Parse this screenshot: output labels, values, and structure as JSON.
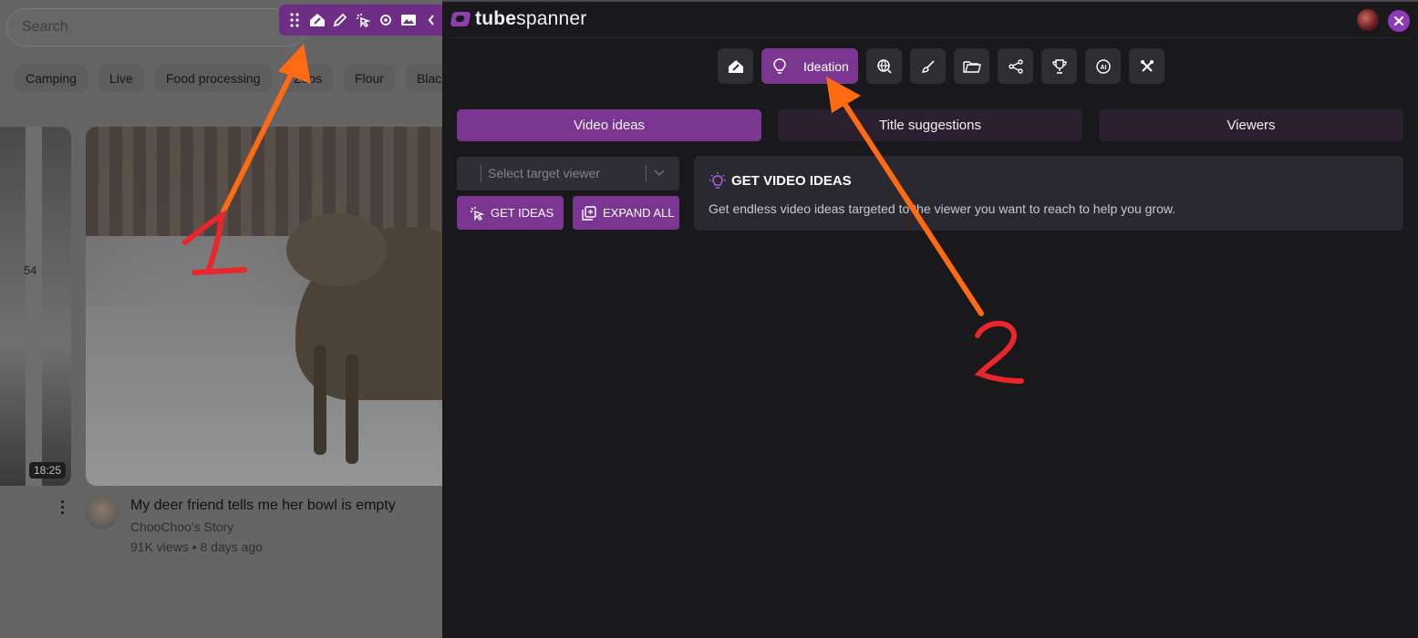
{
  "youtube": {
    "search_placeholder": "Search",
    "chips": [
      "Camping",
      "Live",
      "Food processing",
      "Zoos",
      "Flour",
      "Blac"
    ],
    "left_thumb_duration": "18:25",
    "left_thumb_sign": "54",
    "video": {
      "title": "My deer friend tells me her bowl is empty",
      "channel": "ChooChoo's Story",
      "meta": "91K views • 8 days ago"
    }
  },
  "extension": {
    "brand_first": "tube",
    "brand_second": "spanner",
    "nav": {
      "active_label": "Ideation",
      "items": [
        "dashboard-icon",
        "lightbulb-icon",
        "globe-search-icon",
        "brush-icon",
        "folder-icon",
        "share-icon",
        "trophy-icon",
        "ai-icon",
        "tools-icon"
      ]
    },
    "tabs": [
      "Video ideas",
      "Title suggestions",
      "Viewers"
    ],
    "select_placeholder": "Select target viewer",
    "get_ideas_label": "GET IDEAS",
    "expand_all_label": "EXPAND ALL",
    "info_title": "GET VIDEO IDEAS",
    "info_desc": "Get endless video ideas targeted to the viewer you want to reach to help you grow."
  },
  "annotations": {
    "label_1": "1",
    "label_2": "2"
  },
  "colors": {
    "accent": "#7b3692",
    "arrow": "#ff6a13",
    "handwriting": "#e8262c"
  }
}
